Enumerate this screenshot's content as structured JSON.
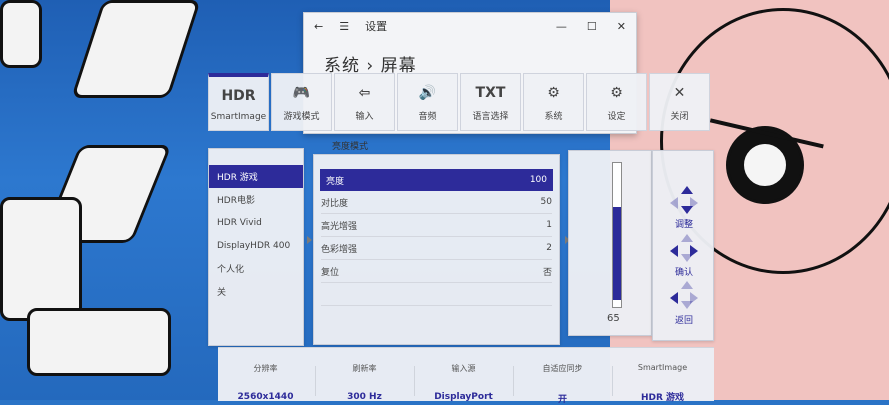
{
  "window": {
    "title": "设置",
    "heading": "系统 › 屏幕",
    "back": "←",
    "menu": "☰",
    "minimize": "—",
    "maximize": "☐",
    "close": "✕",
    "partial_text": "亮度模式"
  },
  "top_menu": [
    {
      "icon": "hdr-icon",
      "label": "SmartImage",
      "icon_text": "HDR"
    },
    {
      "icon": "gamepad-icon",
      "label": "游戏模式",
      "icon_text": "🎮"
    },
    {
      "icon": "input-icon",
      "label": "输入",
      "icon_text": "⇦"
    },
    {
      "icon": "speaker-icon",
      "label": "音频",
      "icon_text": "🔊"
    },
    {
      "icon": "text-icon",
      "label": "语言选择",
      "icon_text": "TXT"
    },
    {
      "icon": "system-icon",
      "label": "系统",
      "icon_text": "⚙"
    },
    {
      "icon": "gear-icon",
      "label": "设定",
      "icon_text": "⚙"
    },
    {
      "icon": "close-icon",
      "label": "关闭",
      "icon_text": "✕"
    }
  ],
  "left_menu": [
    {
      "label": "HDR 游戏",
      "active": true
    },
    {
      "label": "HDR电影",
      "active": false
    },
    {
      "label": "HDR Vivid",
      "active": false
    },
    {
      "label": "DisplayHDR 400",
      "active": false
    },
    {
      "label": "个人化",
      "active": false
    },
    {
      "label": "关",
      "active": false
    }
  ],
  "settings": [
    {
      "name": "亮度",
      "value": "100",
      "active": true
    },
    {
      "name": "对比度",
      "value": "50",
      "active": false
    },
    {
      "name": "高光增强",
      "value": "1",
      "active": false
    },
    {
      "name": "色彩增强",
      "value": "2",
      "active": false
    },
    {
      "name": "复位",
      "value": "否",
      "active": false
    }
  ],
  "slider": {
    "value": "65",
    "fraction": 0.65
  },
  "nav": [
    {
      "label": "调整"
    },
    {
      "label": "确认"
    },
    {
      "label": "返回"
    }
  ],
  "status": [
    {
      "head": "分辨率",
      "value": "2560x1440"
    },
    {
      "head": "刷新率",
      "value": "300 Hz"
    },
    {
      "head": "输入源",
      "value": "DisplayPort"
    },
    {
      "head": "自适应同步",
      "value": "开"
    },
    {
      "head": "SmartImage",
      "value": "HDR 游戏"
    }
  ]
}
